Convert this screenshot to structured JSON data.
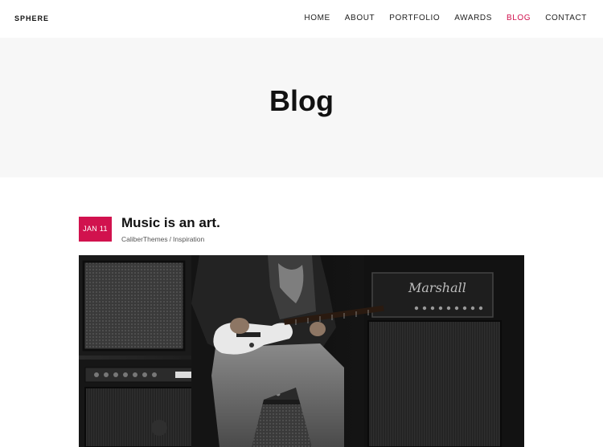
{
  "site": {
    "logo": "SPHERE"
  },
  "nav": {
    "items": [
      {
        "label": "HOME",
        "active": false
      },
      {
        "label": "ABOUT",
        "active": false
      },
      {
        "label": "PORTFOLIO",
        "active": false
      },
      {
        "label": "AWARDS",
        "active": false
      },
      {
        "label": "BLOG",
        "active": true
      },
      {
        "label": "CONTACT",
        "active": false
      }
    ]
  },
  "hero": {
    "title": "Blog"
  },
  "post": {
    "date": "JAN 11",
    "title": "Music is an art.",
    "author": "CaliberThemes",
    "separator": "/",
    "category": "Inspiration",
    "image": {
      "amp_brand": "Marshall"
    }
  },
  "colors": {
    "accent": "#d1124e",
    "hero_bg": "#f7f7f7",
    "text": "#111111"
  }
}
